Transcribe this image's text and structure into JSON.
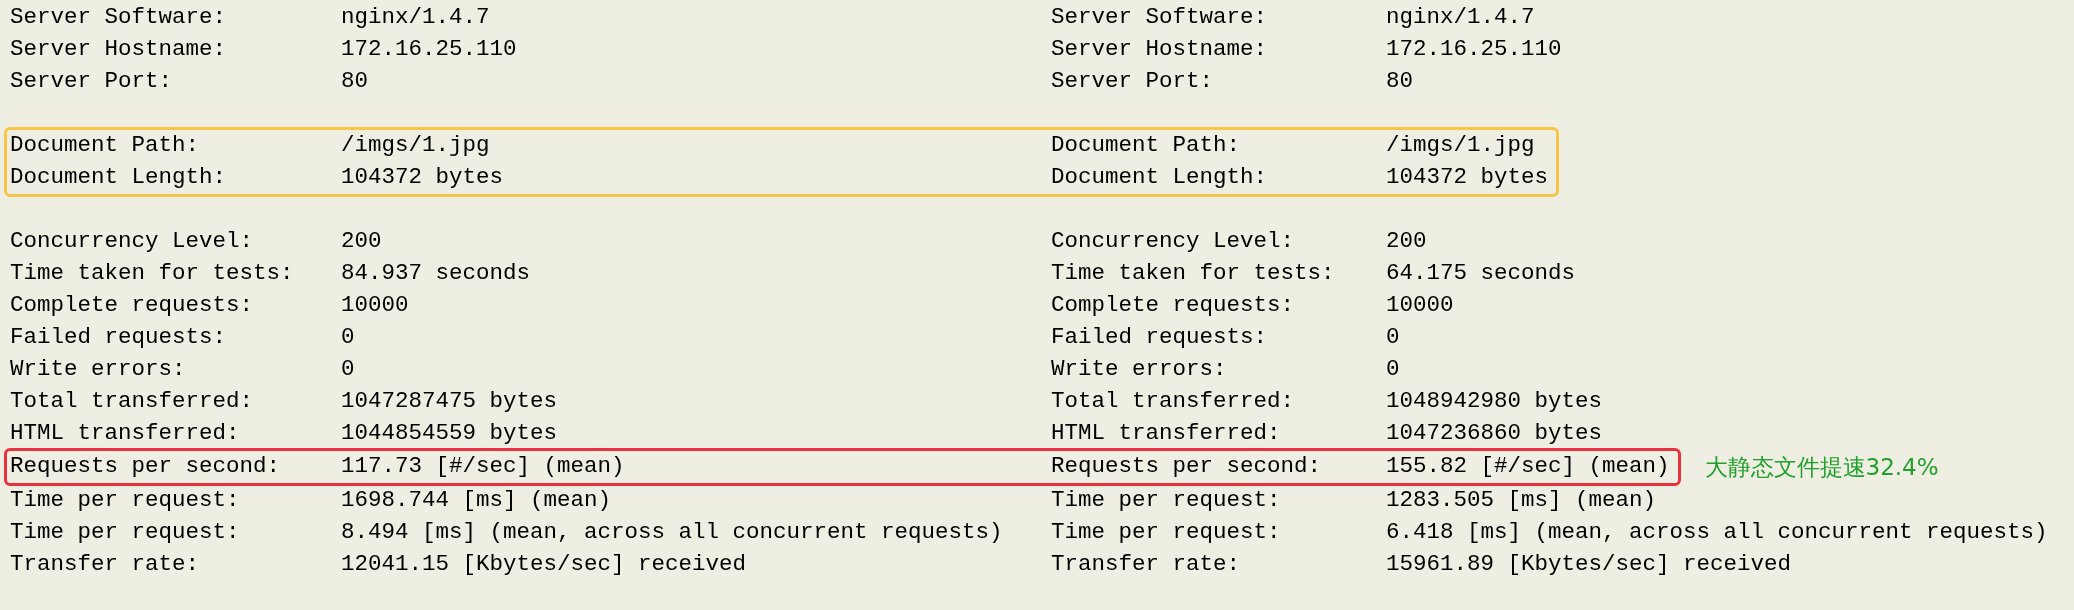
{
  "blocks": [
    {
      "blank_before": false,
      "rows": [
        {
          "left": {
            "label": "Server Software:",
            "value": "nginx/1.4.7"
          },
          "right": {
            "label": "Server Software:",
            "value": "nginx/1.4.7"
          }
        },
        {
          "left": {
            "label": "Server Hostname:",
            "value": "172.16.25.110"
          },
          "right": {
            "label": "Server Hostname:",
            "value": "172.16.25.110"
          }
        },
        {
          "left": {
            "label": "Server Port:",
            "value": "80"
          },
          "right": {
            "label": "Server Port:",
            "value": "80"
          }
        }
      ]
    },
    {
      "blank_before": true,
      "color": "#f8c548",
      "rows": [
        {
          "left": {
            "label": "Document Path:",
            "value": "/imgs/1.jpg"
          },
          "right": {
            "label": "Document Path:",
            "value": "/imgs/1.jpg"
          }
        },
        {
          "left": {
            "label": "Document Length:",
            "value": "104372 bytes"
          },
          "right": {
            "label": "Document Length:",
            "value": "104372 bytes"
          }
        }
      ]
    },
    {
      "blank_before": true,
      "rows": [
        {
          "left": {
            "label": "Concurrency Level:",
            "value": "200"
          },
          "right": {
            "label": "Concurrency Level:",
            "value": "200"
          }
        },
        {
          "left": {
            "label": "Time taken for tests:",
            "value": "84.937 seconds"
          },
          "right": {
            "label": "Time taken for tests:",
            "value": "64.175 seconds"
          }
        },
        {
          "left": {
            "label": "Complete requests:",
            "value": "10000"
          },
          "right": {
            "label": "Complete requests:",
            "value": "10000"
          }
        },
        {
          "left": {
            "label": "Failed requests:",
            "value": "0"
          },
          "right": {
            "label": "Failed requests:",
            "value": "0"
          }
        },
        {
          "left": {
            "label": "Write errors:",
            "value": "0"
          },
          "right": {
            "label": "Write errors:",
            "value": "0"
          }
        },
        {
          "left": {
            "label": "Total transferred:",
            "value": "1047287475 bytes"
          },
          "right": {
            "label": "Total transferred:",
            "value": "1048942980 bytes"
          }
        },
        {
          "left": {
            "label": "HTML transferred:",
            "value": "1044854559 bytes"
          },
          "right": {
            "label": "HTML transferred:",
            "value": "1047236860 bytes"
          }
        }
      ]
    },
    {
      "blank_before": false,
      "color": "#e8323f",
      "note": "大静态文件提速32.4%",
      "rows": [
        {
          "left": {
            "label": "Requests per second:",
            "value": "117.73 [#/sec] (mean)"
          },
          "right": {
            "label": "Requests per second:",
            "value": "155.82 [#/sec] (mean)"
          }
        }
      ]
    },
    {
      "blank_before": false,
      "rows": [
        {
          "left": {
            "label": "Time per request:",
            "value": "1698.744 [ms] (mean)"
          },
          "right": {
            "label": "Time per request:",
            "value": "1283.505 [ms] (mean)"
          }
        },
        {
          "left": {
            "label": "Time per request:",
            "value": "8.494 [ms] (mean, across all concurrent requests)"
          },
          "right": {
            "label": "Time per request:",
            "value": "6.418 [ms] (mean, across all concurrent requests)"
          }
        },
        {
          "left": {
            "label": "Transfer rate:",
            "value": "12041.15 [Kbytes/sec] received"
          },
          "right": {
            "label": "Transfer rate:",
            "value": "15961.89 [Kbytes/sec] received"
          }
        }
      ]
    }
  ]
}
